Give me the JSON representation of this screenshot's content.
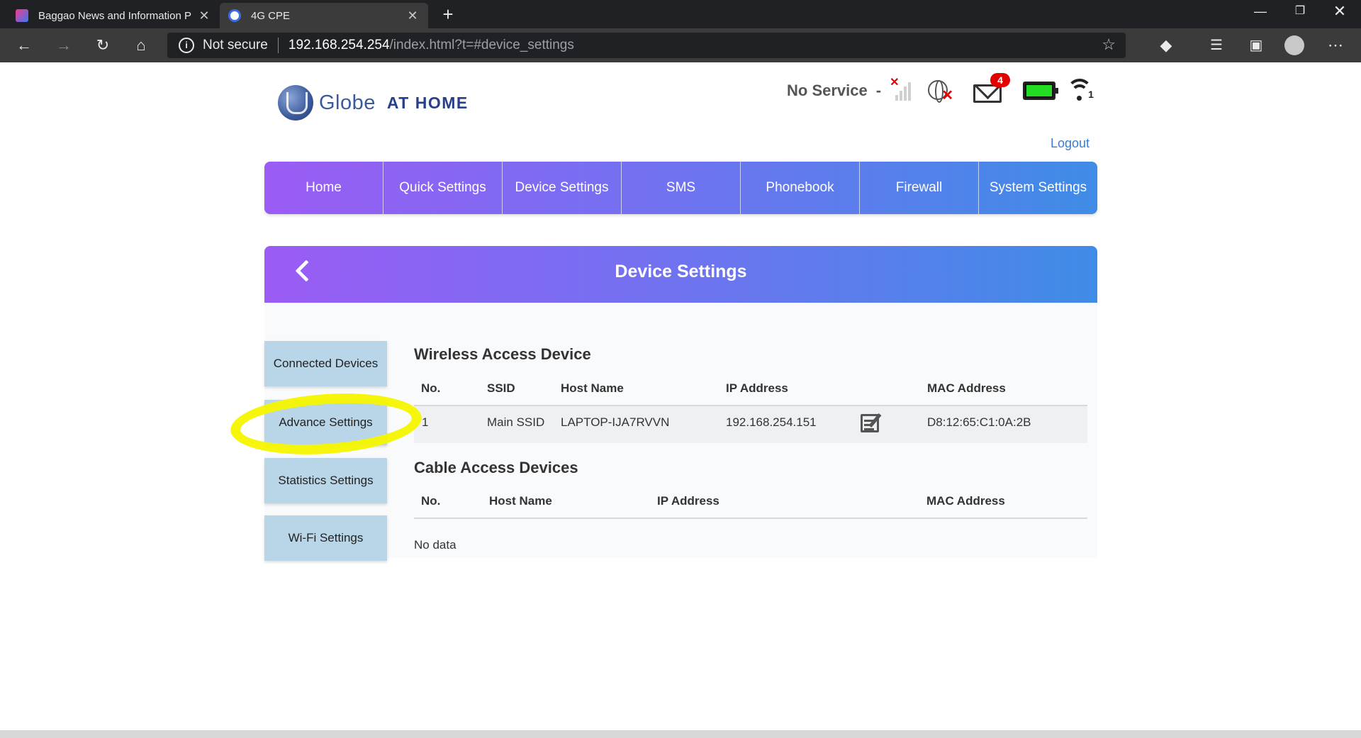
{
  "browser": {
    "tabs": [
      {
        "title": "Baggao News and Information P",
        "active": false
      },
      {
        "title": "4G CPE",
        "active": true
      }
    ],
    "address_bar": {
      "security_label": "Not secure",
      "host": "192.168.254.254",
      "path": "/index.html?t=#device_settings"
    },
    "icons": {
      "back": "arrow-left-icon",
      "forward": "arrow-right-icon",
      "reload": "reload-icon",
      "home": "home-icon",
      "favorite": "star-icon",
      "extension": "extension-icon",
      "favorites_bar": "favorites-icon",
      "collections": "collections-icon",
      "profile": "profile-icon",
      "more": "more-icon"
    }
  },
  "router": {
    "logo": {
      "brand": "Globe",
      "tagline": "AT HOME"
    },
    "status": {
      "network": "No Service",
      "separator": "-",
      "unread_messages": "4",
      "battery_level": 1.0,
      "wifi_clients": "1",
      "colors": {
        "badge": "#e20000",
        "battery": "#22dd22",
        "alert": "#e00000"
      }
    },
    "logout_label": "Logout",
    "nav": [
      {
        "label": "Home"
      },
      {
        "label": "Quick Settings"
      },
      {
        "label": "Device Settings"
      },
      {
        "label": "SMS"
      },
      {
        "label": "Phonebook"
      },
      {
        "label": "Firewall"
      },
      {
        "label": "System Settings"
      }
    ],
    "accent_gradient": [
      "#9b5cf5",
      "#3f8ce6"
    ],
    "section_title": "Device Settings",
    "side_menu": [
      {
        "label": "Connected Devices"
      },
      {
        "label": "Advance Settings"
      },
      {
        "label": "Statistics Settings"
      },
      {
        "label": "Wi-Fi Settings"
      }
    ],
    "highlight_color": "#f5f500",
    "wireless": {
      "title": "Wireless Access Device",
      "columns": [
        "No.",
        "SSID",
        "Host Name",
        "IP Address",
        "MAC Address"
      ],
      "rows": [
        {
          "no": "1",
          "ssid": "Main SSID",
          "host": "LAPTOP-IJA7RVVN",
          "ip": "192.168.254.151",
          "mac": "D8:12:65:C1:0A:2B"
        }
      ]
    },
    "cable": {
      "title": "Cable Access Devices",
      "columns": [
        "No.",
        "Host Name",
        "IP Address",
        "MAC Address"
      ],
      "empty_text": "No data"
    }
  }
}
